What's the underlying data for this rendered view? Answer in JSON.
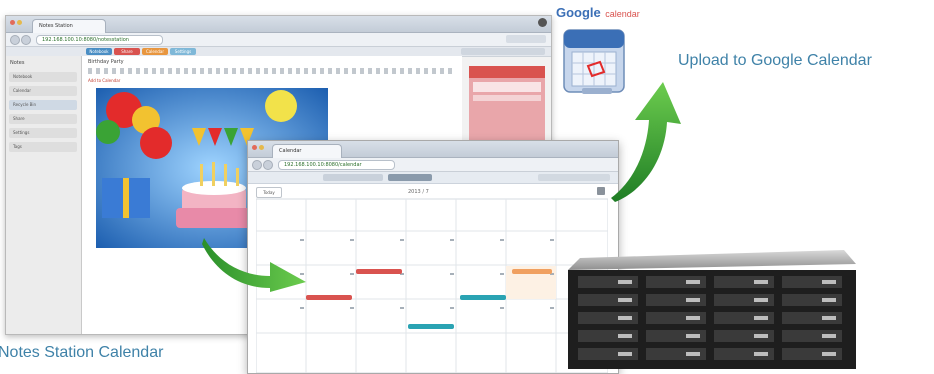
{
  "notes_window": {
    "tab_title": "Notes Station",
    "url": "192.168.100.10:8080/notesstation",
    "toolbar_tabs": [
      "Notebook",
      "Share",
      "Calendar",
      "Settings"
    ],
    "sidebar_title": "Notes",
    "sidebar_items": [
      "Notebook",
      "Calendar",
      "Recycle Bin",
      "Share",
      "Settings",
      "Tags"
    ],
    "editor_title": "Birthday Party",
    "editor_link": "Add to Calendar"
  },
  "calendar_window": {
    "tab_title": "Calendar",
    "url": "192.168.100.10:8080/calendar",
    "today_button": "Today",
    "month_title": "2013 / 7"
  },
  "google_logo": {
    "brand": "Google",
    "product": "calendar"
  },
  "captions": {
    "upload": "Upload to Google Calendar",
    "notes": "Notes Station Calendar"
  },
  "colors": {
    "caption": "#3f82a8",
    "arrow": "#3aa335",
    "event_red": "#d9534f",
    "event_teal": "#2aa3b3",
    "event_orange": "#f0a060",
    "sticky": "#e9a6aa"
  },
  "icons": [
    "arrow-curved-up-icon",
    "arrow-curved-right-icon",
    "google-calendar-icon",
    "nas-server-icon"
  ]
}
